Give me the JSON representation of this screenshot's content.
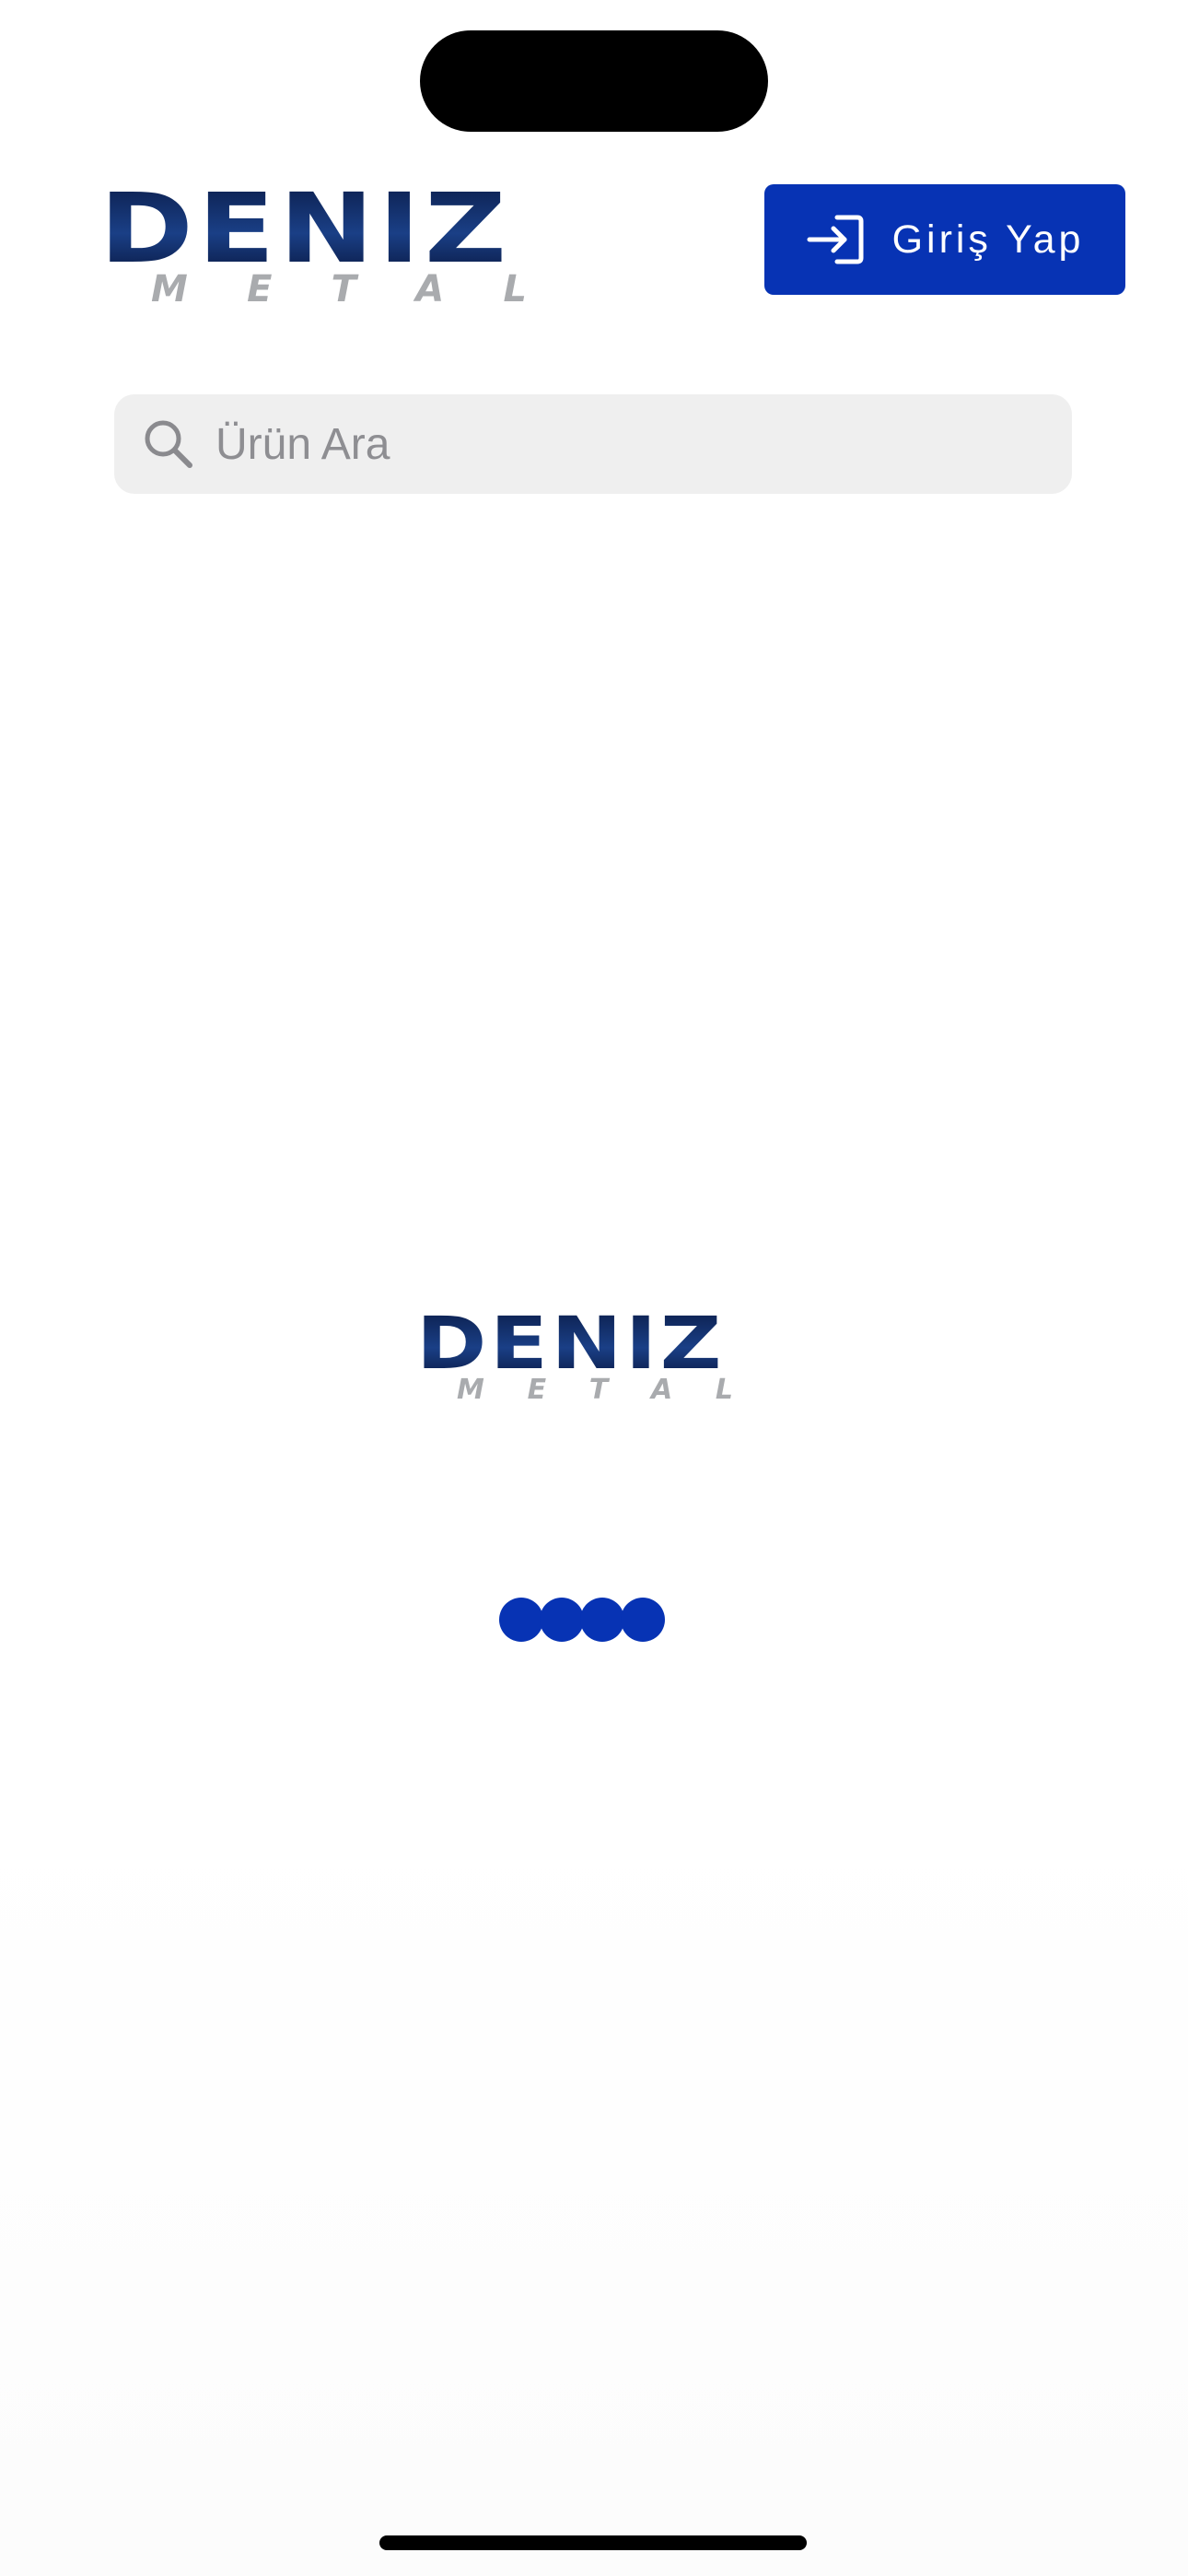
{
  "header": {
    "logo": {
      "main": "DENIZ",
      "sub": [
        "M",
        "E",
        "T",
        "A",
        "L"
      ]
    },
    "login_button": {
      "label": "Giriş Yap",
      "icon": "login-arrow-icon"
    }
  },
  "search": {
    "placeholder": "Ürün Ara",
    "value": "",
    "icon": "search-icon"
  },
  "loading": {
    "logo": {
      "main": "DENIZ",
      "sub": [
        "M",
        "E",
        "T",
        "A",
        "L"
      ]
    },
    "dot_count": 4
  },
  "colors": {
    "brand_blue": "#0733b4",
    "logo_navy": "#0c1f4d",
    "logo_grey": "#a9abae",
    "search_bg": "#efefef"
  }
}
